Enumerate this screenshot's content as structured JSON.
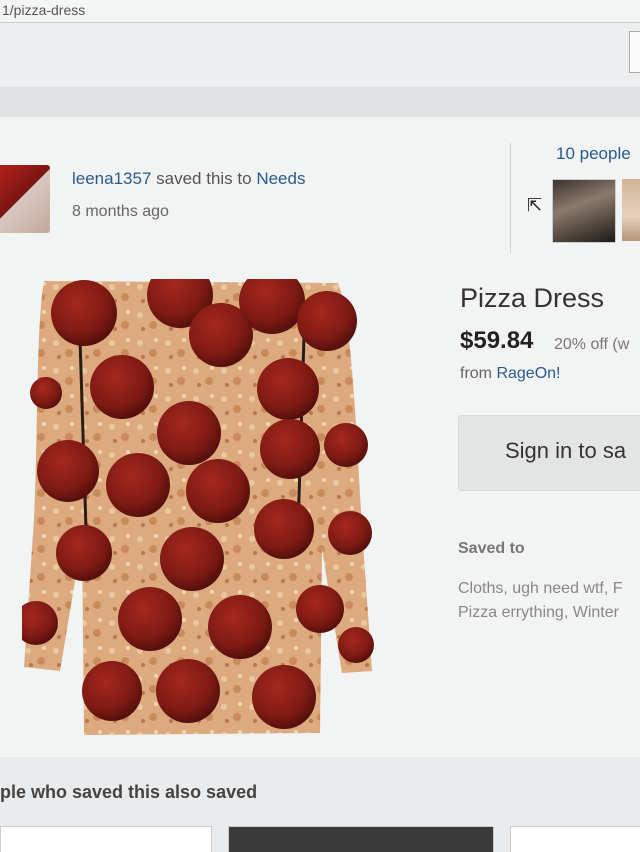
{
  "browser": {
    "url_text": "1/pizza-dress"
  },
  "saver": {
    "username": "leena1357",
    "action_text": " saved this to ",
    "board": "Needs",
    "time_ago": "8 months ago"
  },
  "social": {
    "people_count_text": "10 people"
  },
  "product": {
    "title": "Pizza Dress",
    "price": "$59.84",
    "discount": "20% off (w",
    "from_label": "from ",
    "store": "RageOn!",
    "signin_label": "Sign in to sa",
    "saved_to_label": "Saved to",
    "boards_line1": "Cloths, ugh need wtf, F",
    "boards_line2": "Pizza errything, Winter"
  },
  "related": {
    "heading": "ple who saved this also saved"
  },
  "colors": {
    "link": "#2a5b8c",
    "pepperoni": "#7e1a14",
    "crust": "#d9a878"
  }
}
